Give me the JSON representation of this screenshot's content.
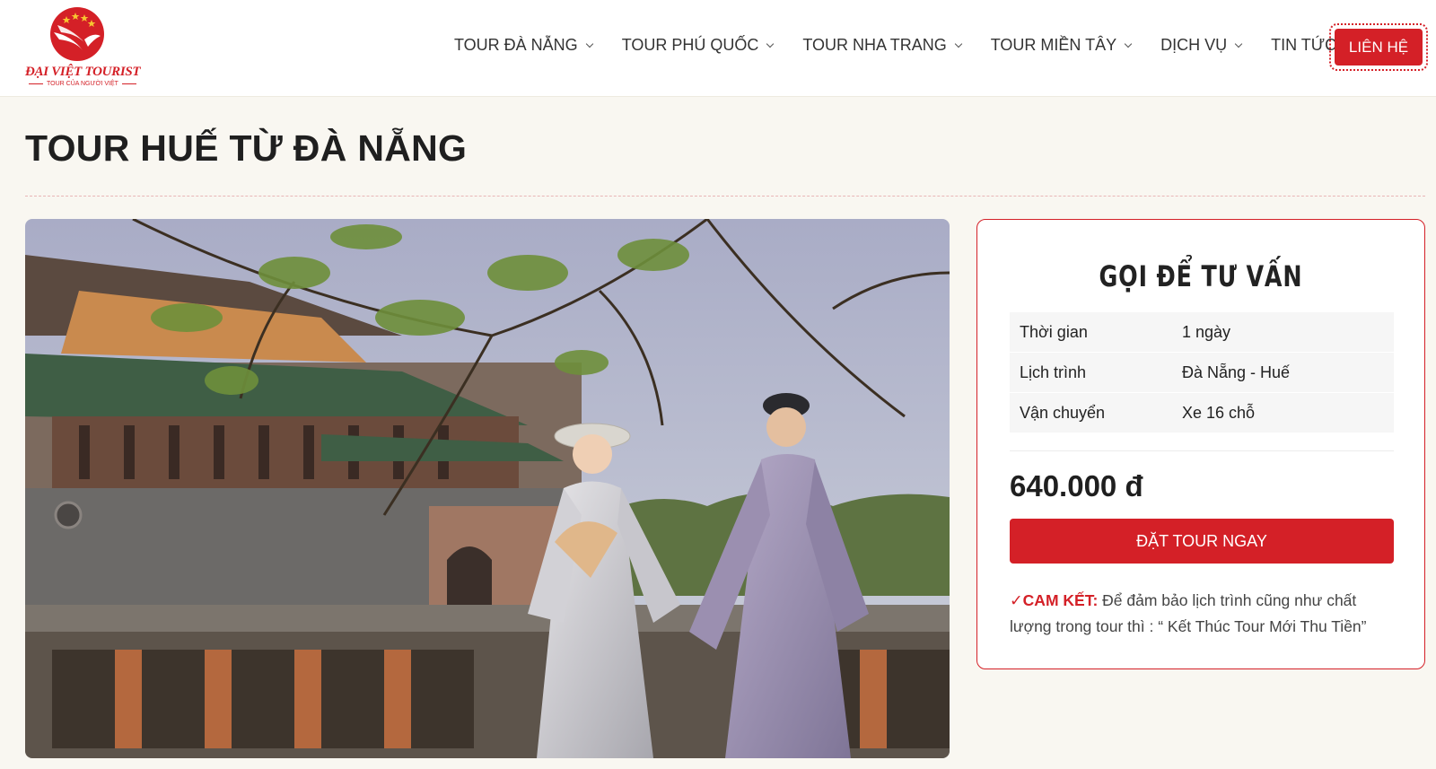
{
  "brand": {
    "name": "ĐẠI VIỆT TOURIST",
    "tagline": "TOUR CỦA NGƯỜI VIỆT",
    "colors": {
      "accent": "#d42027",
      "star": "#f7c531"
    }
  },
  "nav": {
    "items": [
      {
        "label": "TOUR ĐÀ NẴNG"
      },
      {
        "label": "TOUR PHÚ QUỐC"
      },
      {
        "label": "TOUR NHA TRANG"
      },
      {
        "label": "TOUR MIỀN TÂY"
      },
      {
        "label": "DỊCH VỤ"
      },
      {
        "label": "TIN TỨC"
      }
    ],
    "contact_label": "LIÊN HỆ"
  },
  "page": {
    "title": "TOUR HUẾ TỪ ĐÀ NẴNG"
  },
  "booking": {
    "heading": "GỌI ĐỂ TƯ VẤN",
    "rows": [
      {
        "key": "Thời gian",
        "value": "1 ngày"
      },
      {
        "key": "Lịch trình",
        "value": "Đà Nẵng - Huế"
      },
      {
        "key": "Vận chuyển",
        "value": "Xe 16 chỗ"
      }
    ],
    "price": "640.000 đ",
    "cta_label": "ĐẶT TOUR NGAY",
    "commitment_label": "✓CAM KẾT:",
    "commitment_text": " Để đảm bảo lịch trình cũng như chất lượng trong tour thì : “ Kết Thúc Tour Mới Thu Tiền”"
  }
}
